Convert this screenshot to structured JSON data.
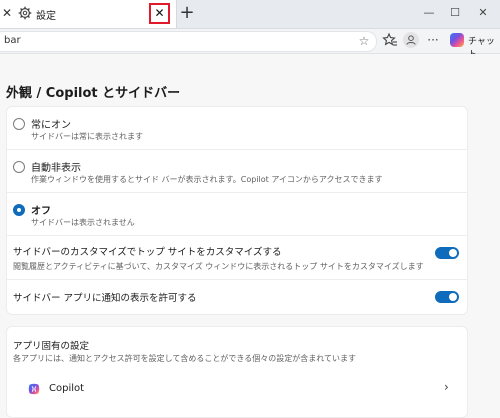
{
  "tab": {
    "close_left": "✕",
    "title": "設定",
    "close": "✕",
    "new_tab": "+"
  },
  "window": {
    "minimize": "—",
    "maximize": "☐",
    "close": "✕"
  },
  "toolbar": {
    "address_text": "bar",
    "chat_label": "チャット",
    "more": "···"
  },
  "page": {
    "title": "外観 / Copilot とサイドバー"
  },
  "visibility": {
    "options": [
      {
        "label": "常にオン",
        "desc": "サイドバーは常に表示されます",
        "selected": false
      },
      {
        "label": "自動非表示",
        "desc": "作業ウィンドウを使用するとサイド バーが表示されます。Copilot アイコンからアクセスできます",
        "selected": false
      },
      {
        "label": "オフ",
        "desc": "サイドバーは表示されません",
        "selected": true
      }
    ],
    "customize": {
      "label": "サイドバーのカスタマイズでトップ サイトをカスタマイズする",
      "desc": "閲覧履歴とアクティビティに基づいて、カスタマイズ ウィンドウに表示されるトップ サイトをカスタマイズします",
      "on": true
    },
    "notifications": {
      "label": "サイドバー アプリに通知の表示を許可する",
      "on": true
    }
  },
  "app_settings": {
    "title": "アプリ固有の設定",
    "desc": "各アプリには、通知とアクセス許可を設定して含めることができる個々の設定が含まれています",
    "apps": [
      {
        "name": "Copilot"
      }
    ]
  },
  "colors": {
    "accent": "#0f6cbd",
    "highlight_box": "#e0192b"
  }
}
